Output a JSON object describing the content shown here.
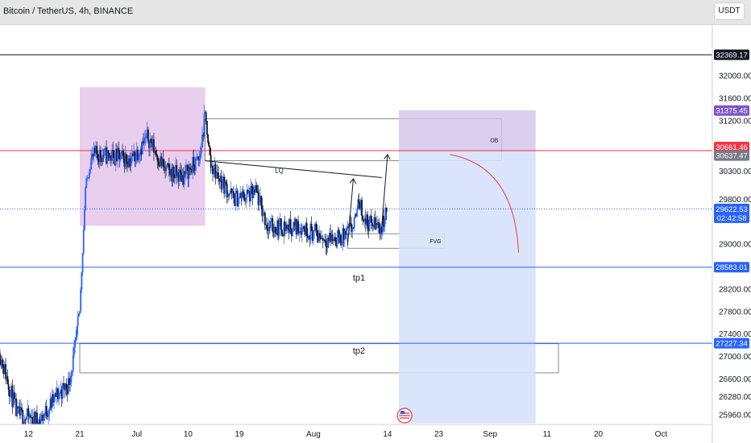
{
  "header": {
    "symbol": "Bitcoin / TetherUS, 4h, BINANCE",
    "currency": "USDT"
  },
  "colors": {
    "up": "#2962ff",
    "down": "#131722",
    "blue_line": "#2962ff",
    "red_line": "#f23645",
    "pink_zone": "#e1bee7",
    "purple_zone": "#d1c4e9",
    "blue_zone": "#d6e2fb",
    "last_price": "#2962ff",
    "ob_price": "#7e57c2",
    "red_price": "#f23645",
    "gray_price": "#787b86"
  },
  "chart_data": {
    "type": "candlestick",
    "title": "Bitcoin / TetherUS, 4h, BINANCE",
    "x_range": [
      "2023-06-07",
      "2023-10-10"
    ],
    "ylim": [
      25780,
      32900
    ],
    "x_ticks": [
      {
        "label": "12",
        "date": "2023-06-12"
      },
      {
        "label": "21",
        "date": "2023-06-21"
      },
      {
        "label": "Jul",
        "date": "2023-07-01"
      },
      {
        "label": "10",
        "date": "2023-07-10"
      },
      {
        "label": "19",
        "date": "2023-07-19"
      },
      {
        "label": "Aug",
        "date": "2023-08-01"
      },
      {
        "label": "14",
        "date": "2023-08-14"
      },
      {
        "label": "23",
        "date": "2023-08-23"
      },
      {
        "label": "Sep",
        "date": "2023-09-01"
      },
      {
        "label": "11",
        "date": "2023-09-11"
      },
      {
        "label": "20",
        "date": "2023-09-20"
      },
      {
        "label": "Oct",
        "date": "2023-10-01"
      }
    ],
    "y_ticks": [
      32000,
      31600,
      31200,
      30300,
      29800,
      29000,
      28200,
      27800,
      27400,
      27000,
      26600,
      26280,
      25960
    ],
    "price_labels": [
      {
        "value": 32369.17,
        "text": "32369.17",
        "role": "black"
      },
      {
        "value": 31375.45,
        "text": "31375.45",
        "role": "purple"
      },
      {
        "value": 30661.46,
        "text": "30661.46",
        "role": "red"
      },
      {
        "value": 30637.47,
        "text": "30637.47",
        "role": "gray"
      },
      {
        "value": 29622.53,
        "text": "29622.53",
        "sub": "02:42:58",
        "role": "last"
      },
      {
        "value": 28583.01,
        "text": "28583.01",
        "role": "blue"
      },
      {
        "value": 27227.34,
        "text": "27227.34",
        "role": "blue"
      }
    ],
    "horizontal_lines": [
      {
        "value": 32369.17,
        "color": "#131722",
        "style": "solid"
      },
      {
        "value": 30661.46,
        "color": "#f23645",
        "style": "solid"
      },
      {
        "value": 29622.53,
        "color": "#2962ff",
        "style": "dotted"
      },
      {
        "value": 28583.01,
        "color": "#2962ff",
        "style": "solid"
      },
      {
        "value": 27227.34,
        "color": "#2962ff",
        "style": "solid"
      }
    ],
    "zones": [
      {
        "kind": "pink",
        "x1": "2023-06-21",
        "x2": "2023-07-13",
        "y1": 31790,
        "y2": 29320
      },
      {
        "kind": "gray",
        "x1": "2023-07-13",
        "x2": "2023-09-03",
        "y1": 31230,
        "y2": 30480,
        "label": "OB"
      },
      {
        "kind": "gray",
        "x1": "2023-08-07",
        "x2": "2023-08-24",
        "y1": 29180,
        "y2": 28920,
        "label": "FVG"
      },
      {
        "kind": "gray",
        "x1": "2023-06-21",
        "x2": "2023-09-13",
        "y1": 27220,
        "y2": 26700
      },
      {
        "kind": "purple",
        "x1": "2023-08-16",
        "x2": "2023-09-09",
        "y1": 31380,
        "y2": 30640
      },
      {
        "kind": "blue",
        "x1": "2023-08-16",
        "x2": "2023-09-09",
        "y1": 30640,
        "y2": 25800
      }
    ],
    "annotations": [
      {
        "text": "LQ",
        "date": "2023-07-26",
        "value": 30320
      },
      {
        "text": "tp1",
        "date": "2023-08-09",
        "value": 28400
      },
      {
        "text": "tp2",
        "date": "2023-08-09",
        "value": 27100
      }
    ],
    "lq_line": {
      "x1": "2023-07-13",
      "y1": 30480,
      "x2": "2023-08-13",
      "y2": 30180
    },
    "arrow_up_1": {
      "x1": "2023-08-07",
      "y1": 28980,
      "x2": "2023-08-08",
      "y2": 30160
    },
    "arrow_up_2": {
      "x1": "2023-08-13",
      "y1": 29320,
      "x2": "2023-08-14",
      "y2": 30590
    },
    "arrow_curve": {
      "x1": "2023-08-25",
      "y1": 30590,
      "x2": "2023-09-06",
      "y2": 28840
    },
    "keyframes": [
      [
        "2023-06-07",
        27050,
        1
      ],
      [
        "2023-06-10",
        25950,
        1
      ],
      [
        "2023-06-14",
        25850,
        1
      ],
      [
        "2023-06-17",
        26300,
        1
      ],
      [
        "2023-06-19",
        26500,
        1
      ],
      [
        "2023-06-20",
        27000,
        1
      ],
      [
        "2023-06-21",
        27800,
        0
      ],
      [
        "2023-06-22",
        30000,
        0
      ],
      [
        "2023-06-23",
        30500,
        1
      ],
      [
        "2023-06-24",
        30600,
        1
      ],
      [
        "2023-06-30",
        30500,
        1
      ],
      [
        "2023-07-03",
        30900,
        1
      ],
      [
        "2023-07-06",
        30300,
        1
      ],
      [
        "2023-07-09",
        30200,
        1
      ],
      [
        "2023-07-12",
        30500,
        1
      ],
      [
        "2023-07-13",
        31300,
        0
      ],
      [
        "2023-07-14",
        30400,
        1
      ],
      [
        "2023-07-18",
        29800,
        1
      ],
      [
        "2023-07-22",
        29900,
        1
      ],
      [
        "2023-07-24",
        29300,
        1
      ],
      [
        "2023-07-26",
        29300,
        1
      ],
      [
        "2023-07-30",
        29300,
        1
      ],
      [
        "2023-08-01",
        29200,
        1
      ],
      [
        "2023-08-03",
        29100,
        1
      ],
      [
        "2023-08-06",
        29100,
        1
      ],
      [
        "2023-08-08",
        29300,
        0
      ],
      [
        "2023-08-09",
        29800,
        1
      ],
      [
        "2023-08-10",
        29400,
        1
      ],
      [
        "2023-08-13",
        29300,
        1
      ],
      [
        "2023-08-14",
        29620,
        1
      ]
    ]
  }
}
